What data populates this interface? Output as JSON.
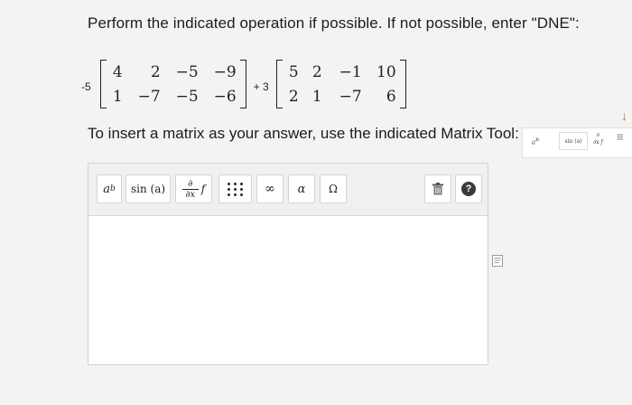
{
  "question": "Perform the indicated operation if possible. If not possible, enter \"DNE\":",
  "expression": {
    "coef1": "-5",
    "matrix1": [
      [
        "4",
        "2",
        "−5",
        "−9"
      ],
      [
        "1",
        "−7",
        "−5",
        "−6"
      ]
    ],
    "operator": "+ 3",
    "matrix2": [
      [
        "5",
        "2",
        "−1",
        "10"
      ],
      [
        "2",
        "1",
        "−7",
        "6"
      ]
    ]
  },
  "instruction": "To insert a matrix as your answer, use the indicated Matrix Tool:",
  "mini_toolbar": {
    "power_base": "a",
    "power_exp": "b",
    "sin_label": "sin (a)",
    "deriv_num": "∂",
    "deriv_den": "∂x",
    "deriv_fn": "f",
    "matrix_glyph": "⁝⁝⁝"
  },
  "toolbar": {
    "power_base": "a",
    "power_exp": "b",
    "sin_label": "sin (a)",
    "deriv_num": "∂",
    "deriv_den": "∂x",
    "deriv_fn": "f",
    "infinity_label": "∞",
    "alpha_label": "α",
    "omega_label": "Ω",
    "help_label": "?"
  },
  "icons": {
    "matrix_tool": "matrix-grid-icon",
    "trash": "trash-icon",
    "help": "help-icon",
    "side": "document-icon",
    "arrow": "arrow-down-icon"
  },
  "colors": {
    "arrow": "#e06a1b",
    "help_bg": "#3a3a3a"
  }
}
